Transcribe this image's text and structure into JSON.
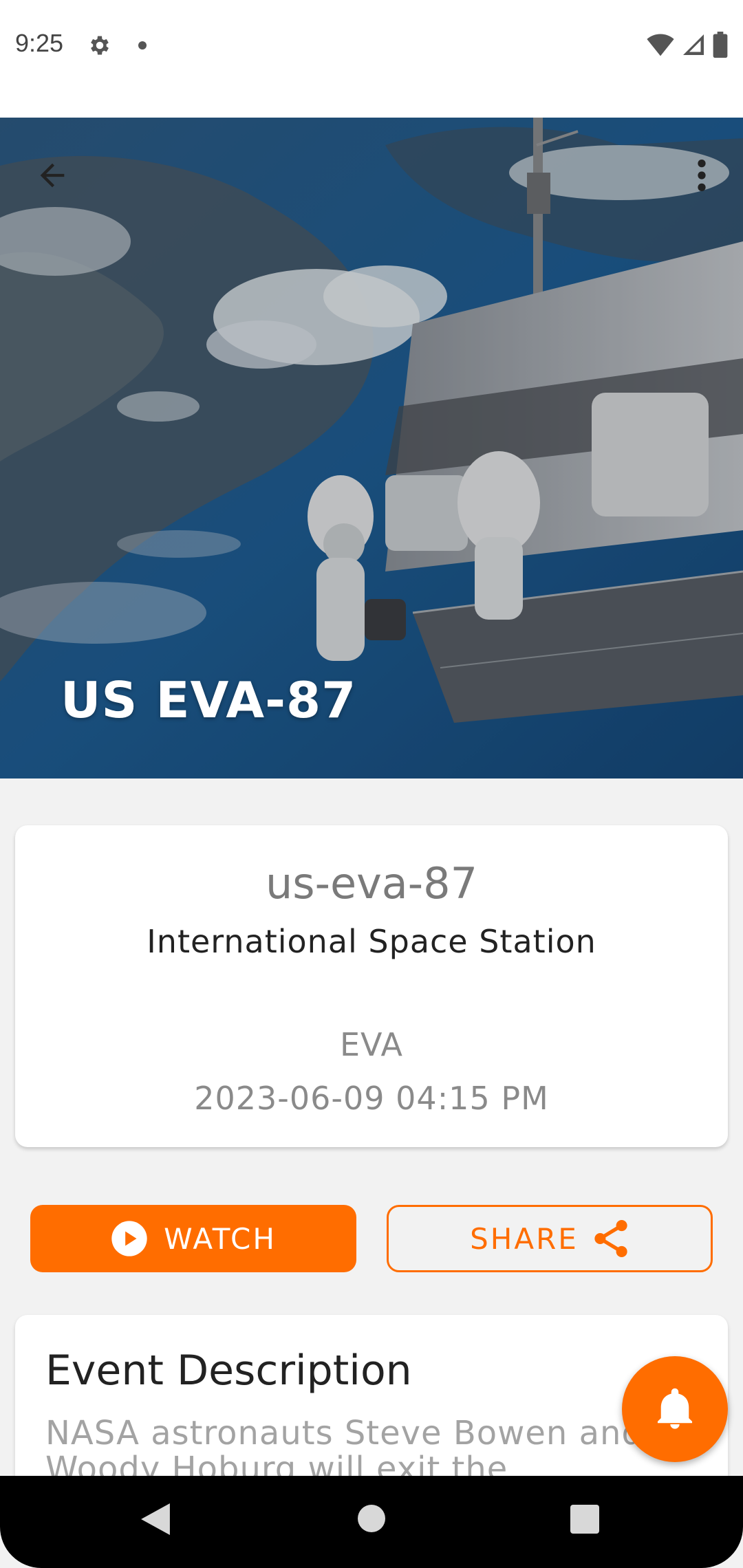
{
  "status_bar": {
    "time": "9:25",
    "icons": [
      "gear-icon",
      "dot-icon",
      "wifi-icon",
      "signal-icon",
      "battery-icon"
    ]
  },
  "hero": {
    "title": "US EVA-87",
    "back_icon": "arrow-back-icon",
    "menu_icon": "more-vert-icon"
  },
  "info": {
    "slug": "us-eva-87",
    "station": "International Space Station",
    "type": "EVA",
    "date": "2023-06-09 04:15 PM"
  },
  "actions": {
    "watch_label": "WATCH",
    "share_label": "SHARE",
    "watch_icon": "play-circle-icon",
    "share_icon": "share-icon"
  },
  "description": {
    "title": "Event Description",
    "text": "NASA astronauts Steve Bowen and Woody Hoburg will exit the station's"
  },
  "fab": {
    "icon": "bell-icon"
  },
  "colors": {
    "accent": "#ff6d00"
  }
}
